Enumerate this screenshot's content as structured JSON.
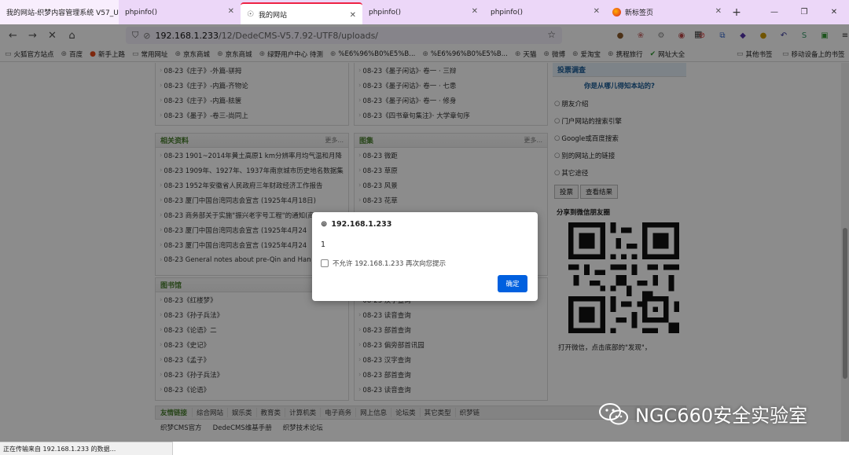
{
  "tabs": [
    {
      "label": "我的网站-织梦内容管理系统 V57_U"
    },
    {
      "label": "phpinfo()"
    },
    {
      "label": "我的网站"
    },
    {
      "label": "phpinfo()"
    },
    {
      "label": "phpinfo()"
    },
    {
      "label": "新标签页"
    }
  ],
  "address": {
    "host": "192.168.1.233",
    "path": "/12/DedeCMS-V5.7.92-UTF8/uploads/"
  },
  "bookmarks": [
    "火狐官方站点",
    "百度",
    "新手上路",
    "常用网址",
    "京东商城",
    "京东商城",
    "绿野用户中心 待测",
    "%E6%96%B0%E5%B...",
    "%E6%96%B0%E5%B...",
    "天猫",
    "微博",
    "爱淘宝",
    "携程旅行",
    "网址大全"
  ],
  "bookmarks_right": [
    "其他书签",
    "移动设备上的书签"
  ],
  "top_left_list": [
    "08-23《庄子》-外篇-骈拇",
    "08-23《庄子》-内篇-齐物论",
    "08-23《庄子》-内篇-胠箧",
    "08-23《墨子》-卷三-尚同上"
  ],
  "top_mid_list": [
    "08-23《墨子闲诂》· 卷一 · 三辩",
    "08-23《墨子闲诂》· 卷一 · 七患",
    "08-23《墨子闲诂》· 卷一 · 修身",
    "08-23《四书章句集注》· 大学章句序"
  ],
  "related": {
    "title": "相关资料",
    "more": "更多...",
    "items": [
      "08-23 1901~2014年黄土高原1 km分辨率月均气温和月降",
      "08-23 1909年、1927年、1937年南京城市历史地名数据集",
      "08-23 1952年安徽省人民政府三年财政经济工作报告",
      "08-23 厦门中国台湾同志会宣言 (1925年4月18日)",
      "08-23 商务部关于实施\"振兴老字号工程\"的通知(商",
      "08-23 厦门中国台湾同志会宣言 (1925年4月24",
      "08-23 厦门中国台湾同志会宣言 (1925年4月24",
      "08-23 General notes about pre-Qin and Han"
    ]
  },
  "gallery": {
    "title": "图集",
    "more": "更多...",
    "items": [
      "08-23 微距",
      "08-23 草原",
      "08-23 风景",
      "08-23 花草"
    ]
  },
  "library": {
    "title": "图书馆",
    "items": [
      "08-23《红楼梦》",
      "08-23《孙子兵法》",
      "08-23《论语》二",
      "08-23《史记》",
      "08-23《孟子》",
      "08-23《孙子兵法》",
      "08-23《论语》"
    ]
  },
  "tools": {
    "items": [
      "08-23 汉字查询",
      "08-23 读音查询",
      "08-23 部首查询",
      "08-23 偏旁部首讯园",
      "08-23 汉字查询",
      "08-23 部首查询",
      "08-23 读音查询"
    ]
  },
  "vote": {
    "title": "投票调查",
    "question": "你是从哪儿得知本站的?",
    "options": [
      "朋友介绍",
      "门户网站的搜索引擎",
      "Google或百度搜索",
      "别的网站上的链接",
      "其它途径"
    ],
    "vote_btn": "投票",
    "result_btn": "查看结果"
  },
  "share": {
    "title": "分享到微信朋友圈",
    "hint": "打开微信，点击底部的\"发现\"，"
  },
  "links": {
    "title": "友情链接",
    "cats": [
      "综合网站",
      "娱乐类",
      "教育类",
      "计算机类",
      "电子商务",
      "网上信息",
      "论坛类",
      "其它类型",
      "织梦链"
    ],
    "sites": [
      "织梦CMS官方",
      "DedeCMS维基手册",
      "织梦技术论坛"
    ]
  },
  "dialog": {
    "origin": "192.168.1.233",
    "message": "1",
    "checkbox": "不允许 192.168.1.233 再次向您提示",
    "ok": "确定"
  },
  "status": "正在传输来自 192.168.1.233 的数据...",
  "watermark": "NGC660安全实验室"
}
